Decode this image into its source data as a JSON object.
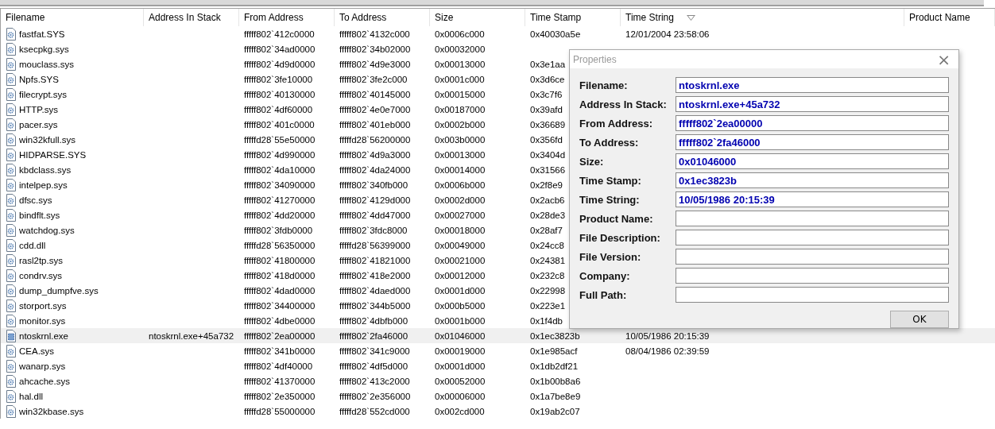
{
  "table": {
    "columns": [
      {
        "label": "Filename",
        "sorted": false
      },
      {
        "label": "Address In Stack",
        "sorted": false
      },
      {
        "label": "From Address",
        "sorted": false
      },
      {
        "label": "To Address",
        "sorted": false
      },
      {
        "label": "Size",
        "sorted": false
      },
      {
        "label": "Time Stamp",
        "sorted": false
      },
      {
        "label": "Time String",
        "sorted": true
      },
      {
        "label": "Product Name",
        "sorted": false
      }
    ],
    "rows": [
      {
        "kind": "driver",
        "selected": false,
        "cells": [
          "fastfat.SYS",
          null,
          "fffff802`412c0000",
          "fffff802`4132c000",
          "0x0006c000",
          "0x40030a5e",
          "12/01/2004 23:58:06"
        ]
      },
      {
        "kind": "driver",
        "selected": false,
        "cells": [
          "ksecpkg.sys",
          null,
          "fffff802`34ad0000",
          "fffff802`34b02000",
          "0x00032000"
        ]
      },
      {
        "kind": "driver",
        "selected": false,
        "cells": [
          "mouclass.sys",
          null,
          "fffff802`4d9d0000",
          "fffff802`4d9e3000",
          "0x00013000",
          "0x3e1aa"
        ]
      },
      {
        "kind": "driver",
        "selected": false,
        "cells": [
          "Npfs.SYS",
          null,
          "fffff802`3fe10000",
          "fffff802`3fe2c000",
          "0x0001c000",
          "0x3d6ce"
        ]
      },
      {
        "kind": "driver",
        "selected": false,
        "cells": [
          "filecrypt.sys",
          null,
          "fffff802`40130000",
          "fffff802`40145000",
          "0x00015000",
          "0x3c7f6"
        ]
      },
      {
        "kind": "driver",
        "selected": false,
        "cells": [
          "HTTP.sys",
          null,
          "fffff802`4df60000",
          "fffff802`4e0e7000",
          "0x00187000",
          "0x39afd"
        ]
      },
      {
        "kind": "driver",
        "selected": false,
        "cells": [
          "pacer.sys",
          null,
          "fffff802`401c0000",
          "fffff802`401eb000",
          "0x0002b000",
          "0x36689"
        ]
      },
      {
        "kind": "driver",
        "selected": false,
        "cells": [
          "win32kfull.sys",
          null,
          "fffffd28`55e50000",
          "fffffd28`56200000",
          "0x003b0000",
          "0x356fd"
        ]
      },
      {
        "kind": "driver",
        "selected": false,
        "cells": [
          "HIDPARSE.SYS",
          null,
          "fffff802`4d990000",
          "fffff802`4d9a3000",
          "0x00013000",
          "0x3404d"
        ]
      },
      {
        "kind": "driver",
        "selected": false,
        "cells": [
          "kbdclass.sys",
          null,
          "fffff802`4da10000",
          "fffff802`4da24000",
          "0x00014000",
          "0x31566"
        ]
      },
      {
        "kind": "driver",
        "selected": false,
        "cells": [
          "intelpep.sys",
          null,
          "fffff802`34090000",
          "fffff802`340fb000",
          "0x0006b000",
          "0x2f8e9"
        ]
      },
      {
        "kind": "driver",
        "selected": false,
        "cells": [
          "dfsc.sys",
          null,
          "fffff802`41270000",
          "fffff802`4129d000",
          "0x0002d000",
          "0x2acb6"
        ]
      },
      {
        "kind": "driver",
        "selected": false,
        "cells": [
          "bindflt.sys",
          null,
          "fffff802`4dd20000",
          "fffff802`4dd47000",
          "0x00027000",
          "0x28de3"
        ]
      },
      {
        "kind": "driver",
        "selected": false,
        "cells": [
          "watchdog.sys",
          null,
          "fffff802`3fdb0000",
          "fffff802`3fdc8000",
          "0x00018000",
          "0x28af7"
        ]
      },
      {
        "kind": "driver",
        "selected": false,
        "cells": [
          "cdd.dll",
          null,
          "fffffd28`56350000",
          "fffffd28`56399000",
          "0x00049000",
          "0x24cc8"
        ]
      },
      {
        "kind": "driver",
        "selected": false,
        "cells": [
          "rasl2tp.sys",
          null,
          "fffff802`41800000",
          "fffff802`41821000",
          "0x00021000",
          "0x24381"
        ]
      },
      {
        "kind": "driver",
        "selected": false,
        "cells": [
          "condrv.sys",
          null,
          "fffff802`418d0000",
          "fffff802`418e2000",
          "0x00012000",
          "0x232c8"
        ]
      },
      {
        "kind": "driver",
        "selected": false,
        "cells": [
          "dump_dumpfve.sys",
          null,
          "fffff802`4dad0000",
          "fffff802`4daed000",
          "0x0001d000",
          "0x22998"
        ]
      },
      {
        "kind": "driver",
        "selected": false,
        "cells": [
          "storport.sys",
          null,
          "fffff802`34400000",
          "fffff802`344b5000",
          "0x000b5000",
          "0x223e1"
        ]
      },
      {
        "kind": "driver",
        "selected": false,
        "cells": [
          "monitor.sys",
          null,
          "fffff802`4dbe0000",
          "fffff802`4dbfb000",
          "0x0001b000",
          "0x1f4db"
        ]
      },
      {
        "kind": "exe",
        "selected": true,
        "cells": [
          "ntoskrnl.exe",
          "ntoskrnl.exe+45a732",
          "fffff802`2ea00000",
          "fffff802`2fa46000",
          "0x01046000",
          "0x1ec3823b",
          "10/05/1986 20:15:39"
        ]
      },
      {
        "kind": "driver",
        "selected": false,
        "cells": [
          "CEA.sys",
          null,
          "fffff802`341b0000",
          "fffff802`341c9000",
          "0x00019000",
          "0x1e985acf",
          "08/04/1986 02:39:59"
        ]
      },
      {
        "kind": "driver",
        "selected": false,
        "cells": [
          "wanarp.sys",
          null,
          "fffff802`4df40000",
          "fffff802`4df5d000",
          "0x0001d000",
          "0x1db2df21"
        ]
      },
      {
        "kind": "driver",
        "selected": false,
        "cells": [
          "ahcache.sys",
          null,
          "fffff802`41370000",
          "fffff802`413c2000",
          "0x00052000",
          "0x1b00b8a6"
        ]
      },
      {
        "kind": "driver",
        "selected": false,
        "cells": [
          "hal.dll",
          null,
          "fffff802`2e350000",
          "fffff802`2e356000",
          "0x00006000",
          "0x1a7be8e9"
        ]
      },
      {
        "kind": "driver",
        "selected": false,
        "cells": [
          "win32kbase.sys",
          null,
          "fffffd28`55000000",
          "fffffd28`552cd000",
          "0x002cd000",
          "0x19ab2c07"
        ]
      }
    ]
  },
  "dialog": {
    "title": "Properties",
    "close": "×",
    "fields": [
      {
        "label": "Filename:",
        "value": "ntoskrnl.exe"
      },
      {
        "label": "Address In Stack:",
        "value": "ntoskrnl.exe+45a732"
      },
      {
        "label": "From Address:",
        "value": "fffff802`2ea00000"
      },
      {
        "label": "To Address:",
        "value": "fffff802`2fa46000"
      },
      {
        "label": "Size:",
        "value": "0x01046000"
      },
      {
        "label": "Time Stamp:",
        "value": "0x1ec3823b"
      },
      {
        "label": "Time String:",
        "value": "10/05/1986 20:15:39"
      },
      {
        "label": "Product Name:"
      },
      {
        "label": "File Description:"
      },
      {
        "label": "File Version:"
      },
      {
        "label": "Company:"
      },
      {
        "label": "Full Path:"
      }
    ],
    "button": "OK"
  }
}
